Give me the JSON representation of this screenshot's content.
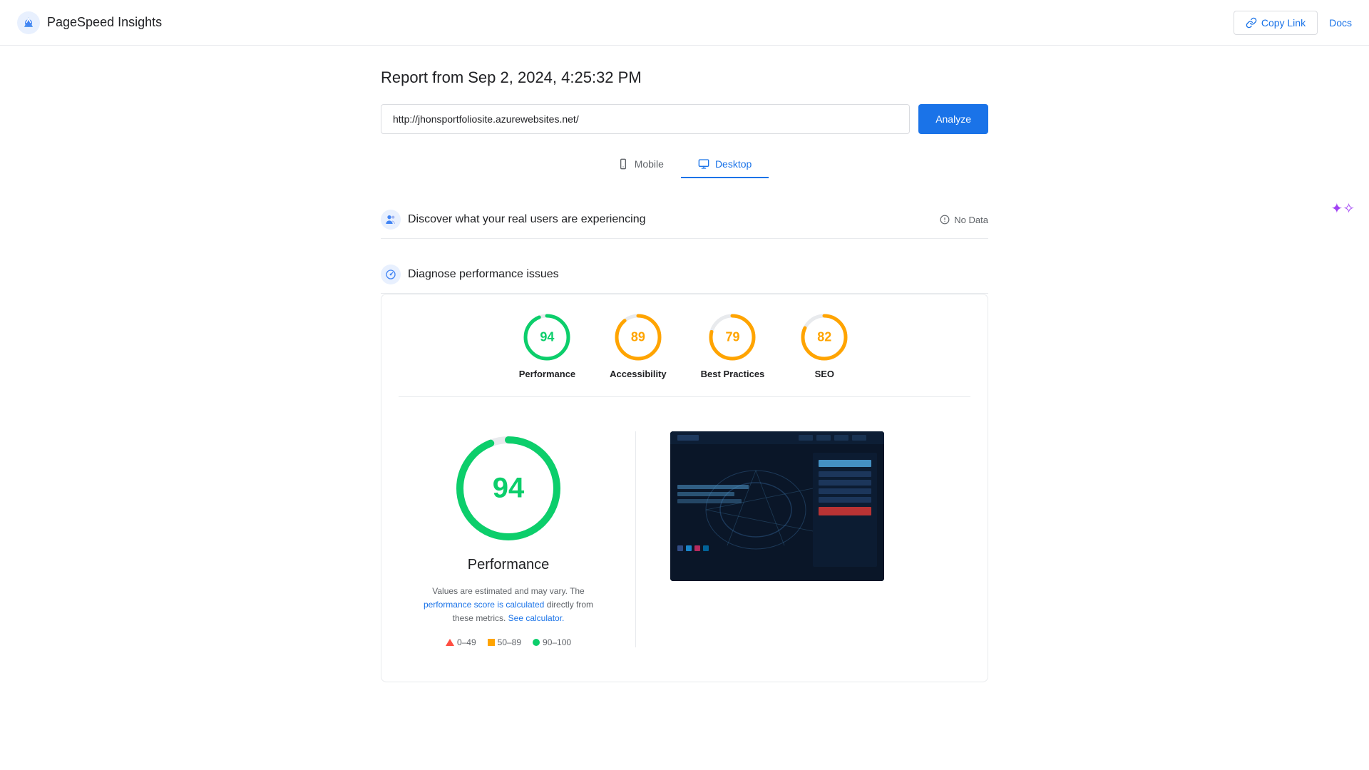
{
  "header": {
    "logo_text": "PageSpeed Insights",
    "copy_link_label": "Copy Link",
    "docs_label": "Docs"
  },
  "report": {
    "title": "Report from Sep 2, 2024, 4:25:32 PM",
    "url_value": "http://jhonsportfoliosite.azurewebsites.net/",
    "url_placeholder": "Enter a web page URL",
    "analyze_label": "Analyze"
  },
  "tabs": [
    {
      "id": "mobile",
      "label": "Mobile",
      "active": false
    },
    {
      "id": "desktop",
      "label": "Desktop",
      "active": true
    }
  ],
  "sections": {
    "real_users": {
      "title": "Discover what your real users are experiencing",
      "no_data_label": "No Data"
    },
    "diagnose": {
      "title": "Diagnose performance issues"
    }
  },
  "scores": [
    {
      "id": "performance",
      "value": 94,
      "label": "Performance",
      "color": "green",
      "pct": 94
    },
    {
      "id": "accessibility",
      "value": 89,
      "label": "Accessibility",
      "color": "orange",
      "pct": 89
    },
    {
      "id": "best_practices",
      "value": 79,
      "label": "Best Practices",
      "color": "orange",
      "pct": 79
    },
    {
      "id": "seo",
      "value": 82,
      "label": "SEO",
      "color": "orange",
      "pct": 82
    }
  ],
  "performance_detail": {
    "score": 94,
    "title": "Performance",
    "desc_part1": "Values are estimated and may vary. The ",
    "desc_link1": "performance score is calculated",
    "desc_part2": " directly from these metrics. ",
    "desc_link2": "See calculator.",
    "legend": [
      {
        "type": "triangle",
        "range": "0–49"
      },
      {
        "type": "square",
        "color": "#ffa400",
        "range": "50–89"
      },
      {
        "type": "dot",
        "color": "#0cce6b",
        "range": "90–100"
      }
    ]
  }
}
